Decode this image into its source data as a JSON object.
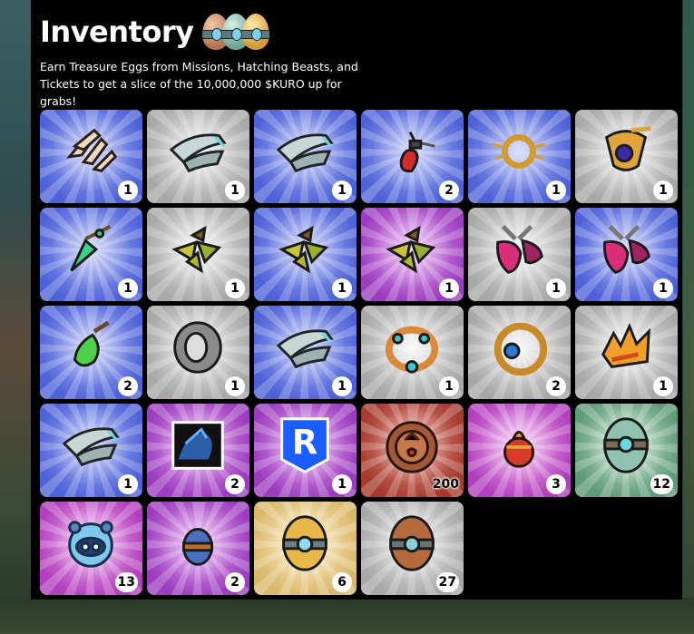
{
  "header": {
    "title": "Inventory",
    "subtitle": "Earn Treasure Eggs from Missions, Hatching Beasts, and Tickets to get a slice of the 10,000,000 $KURO up for grabs!"
  },
  "colors": {
    "blue": [
      "#4f63d8",
      "#aab6f3"
    ],
    "gray": [
      "#a8a8a8",
      "#ececec"
    ],
    "purple": [
      "#9c3dbf",
      "#e6a6f0"
    ],
    "red": [
      "#a63a2e",
      "#e6998c"
    ],
    "pink": [
      "#b23fbd",
      "#f2b3ef"
    ],
    "green": [
      "#5f9a79",
      "#c8e6d2"
    ],
    "gold": [
      "#d9b86a",
      "#fff0c4"
    ]
  },
  "items": [
    {
      "name": "claw-gauntlet",
      "bg": "blue",
      "icon": "claw-icon",
      "count": "1"
    },
    {
      "name": "silver-helm",
      "bg": "gray",
      "icon": "silver-helm-icon",
      "count": "1"
    },
    {
      "name": "silver-helm",
      "bg": "blue",
      "icon": "silver-helm-icon",
      "count": "1"
    },
    {
      "name": "ruby-pendant",
      "bg": "blue",
      "icon": "ruby-pendant-icon",
      "count": "2"
    },
    {
      "name": "gold-ring-amulet",
      "bg": "blue",
      "icon": "gold-amulet-icon",
      "count": "1"
    },
    {
      "name": "sapphire-crown",
      "bg": "gray",
      "icon": "sapphire-crown-icon",
      "count": "1"
    },
    {
      "name": "emerald-necklace",
      "bg": "blue",
      "icon": "emerald-necklace-icon",
      "count": "1"
    },
    {
      "name": "leaf-charm",
      "bg": "gray",
      "icon": "leaf-charm-icon",
      "count": "1"
    },
    {
      "name": "leaf-charm",
      "bg": "blue",
      "icon": "leaf-charm-icon",
      "count": "1"
    },
    {
      "name": "leaf-charm",
      "bg": "purple",
      "icon": "leaf-charm-icon",
      "count": "1"
    },
    {
      "name": "pink-wings",
      "bg": "gray",
      "icon": "pink-wings-icon",
      "count": "1"
    },
    {
      "name": "pink-wings",
      "bg": "blue",
      "icon": "pink-wings-icon",
      "count": "1"
    },
    {
      "name": "green-pendant",
      "bg": "blue",
      "icon": "green-pendant-icon",
      "count": "2"
    },
    {
      "name": "stone-ring",
      "bg": "gray",
      "icon": "stone-ring-icon",
      "count": "1"
    },
    {
      "name": "silver-helm-b",
      "bg": "blue",
      "icon": "silver-helm-icon",
      "count": "1"
    },
    {
      "name": "jewel-collar",
      "bg": "gray",
      "icon": "jewel-collar-icon",
      "count": "1"
    },
    {
      "name": "gold-ring",
      "bg": "gray",
      "icon": "gold-ring-icon",
      "count": "2"
    },
    {
      "name": "fire-crown",
      "bg": "gray",
      "icon": "fire-crown-icon",
      "count": "1"
    },
    {
      "name": "silver-helm-c",
      "bg": "blue",
      "icon": "silver-helm-icon",
      "count": "1"
    },
    {
      "name": "shadow-beast-card",
      "bg": "purple",
      "icon": "shadow-card-icon",
      "count": "2"
    },
    {
      "name": "ronin-token",
      "bg": "purple",
      "icon": "ronin-logo-icon",
      "count": "1"
    },
    {
      "name": "bronze-coin",
      "bg": "red",
      "icon": "bronze-coin-icon",
      "count": "200"
    },
    {
      "name": "ruby-egg",
      "bg": "pink",
      "icon": "ruby-egg-icon",
      "count": "3"
    },
    {
      "name": "jade-egg",
      "bg": "green",
      "icon": "jade-egg-icon",
      "count": "12"
    },
    {
      "name": "ice-beast",
      "bg": "pink",
      "icon": "ice-beast-icon",
      "count": "13"
    },
    {
      "name": "blue-egg",
      "bg": "purple",
      "icon": "blue-egg-icon",
      "count": "2"
    },
    {
      "name": "gold-egg",
      "bg": "gold",
      "icon": "gold-egg-icon",
      "count": "6"
    },
    {
      "name": "bronze-egg",
      "bg": "gray",
      "icon": "bronze-egg-icon",
      "count": "27"
    }
  ]
}
